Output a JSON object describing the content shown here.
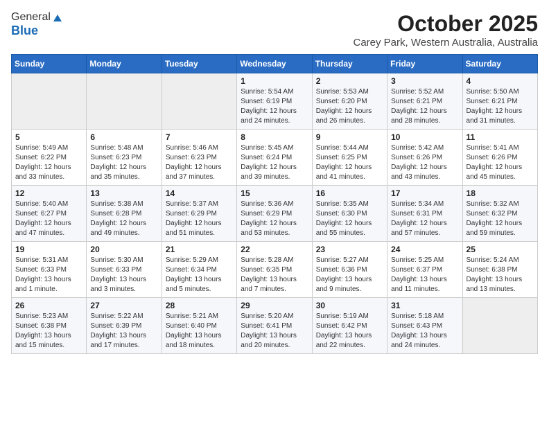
{
  "logo": {
    "line1": "General",
    "line2": "Blue"
  },
  "title": "October 2025",
  "subtitle": "Carey Park, Western Australia, Australia",
  "days_of_week": [
    "Sunday",
    "Monday",
    "Tuesday",
    "Wednesday",
    "Thursday",
    "Friday",
    "Saturday"
  ],
  "weeks": [
    [
      {
        "day": "",
        "text": ""
      },
      {
        "day": "",
        "text": ""
      },
      {
        "day": "",
        "text": ""
      },
      {
        "day": "1",
        "text": "Sunrise: 5:54 AM\nSunset: 6:19 PM\nDaylight: 12 hours\nand 24 minutes."
      },
      {
        "day": "2",
        "text": "Sunrise: 5:53 AM\nSunset: 6:20 PM\nDaylight: 12 hours\nand 26 minutes."
      },
      {
        "day": "3",
        "text": "Sunrise: 5:52 AM\nSunset: 6:21 PM\nDaylight: 12 hours\nand 28 minutes."
      },
      {
        "day": "4",
        "text": "Sunrise: 5:50 AM\nSunset: 6:21 PM\nDaylight: 12 hours\nand 31 minutes."
      }
    ],
    [
      {
        "day": "5",
        "text": "Sunrise: 5:49 AM\nSunset: 6:22 PM\nDaylight: 12 hours\nand 33 minutes."
      },
      {
        "day": "6",
        "text": "Sunrise: 5:48 AM\nSunset: 6:23 PM\nDaylight: 12 hours\nand 35 minutes."
      },
      {
        "day": "7",
        "text": "Sunrise: 5:46 AM\nSunset: 6:23 PM\nDaylight: 12 hours\nand 37 minutes."
      },
      {
        "day": "8",
        "text": "Sunrise: 5:45 AM\nSunset: 6:24 PM\nDaylight: 12 hours\nand 39 minutes."
      },
      {
        "day": "9",
        "text": "Sunrise: 5:44 AM\nSunset: 6:25 PM\nDaylight: 12 hours\nand 41 minutes."
      },
      {
        "day": "10",
        "text": "Sunrise: 5:42 AM\nSunset: 6:26 PM\nDaylight: 12 hours\nand 43 minutes."
      },
      {
        "day": "11",
        "text": "Sunrise: 5:41 AM\nSunset: 6:26 PM\nDaylight: 12 hours\nand 45 minutes."
      }
    ],
    [
      {
        "day": "12",
        "text": "Sunrise: 5:40 AM\nSunset: 6:27 PM\nDaylight: 12 hours\nand 47 minutes."
      },
      {
        "day": "13",
        "text": "Sunrise: 5:38 AM\nSunset: 6:28 PM\nDaylight: 12 hours\nand 49 minutes."
      },
      {
        "day": "14",
        "text": "Sunrise: 5:37 AM\nSunset: 6:29 PM\nDaylight: 12 hours\nand 51 minutes."
      },
      {
        "day": "15",
        "text": "Sunrise: 5:36 AM\nSunset: 6:29 PM\nDaylight: 12 hours\nand 53 minutes."
      },
      {
        "day": "16",
        "text": "Sunrise: 5:35 AM\nSunset: 6:30 PM\nDaylight: 12 hours\nand 55 minutes."
      },
      {
        "day": "17",
        "text": "Sunrise: 5:34 AM\nSunset: 6:31 PM\nDaylight: 12 hours\nand 57 minutes."
      },
      {
        "day": "18",
        "text": "Sunrise: 5:32 AM\nSunset: 6:32 PM\nDaylight: 12 hours\nand 59 minutes."
      }
    ],
    [
      {
        "day": "19",
        "text": "Sunrise: 5:31 AM\nSunset: 6:33 PM\nDaylight: 13 hours\nand 1 minute."
      },
      {
        "day": "20",
        "text": "Sunrise: 5:30 AM\nSunset: 6:33 PM\nDaylight: 13 hours\nand 3 minutes."
      },
      {
        "day": "21",
        "text": "Sunrise: 5:29 AM\nSunset: 6:34 PM\nDaylight: 13 hours\nand 5 minutes."
      },
      {
        "day": "22",
        "text": "Sunrise: 5:28 AM\nSunset: 6:35 PM\nDaylight: 13 hours\nand 7 minutes."
      },
      {
        "day": "23",
        "text": "Sunrise: 5:27 AM\nSunset: 6:36 PM\nDaylight: 13 hours\nand 9 minutes."
      },
      {
        "day": "24",
        "text": "Sunrise: 5:25 AM\nSunset: 6:37 PM\nDaylight: 13 hours\nand 11 minutes."
      },
      {
        "day": "25",
        "text": "Sunrise: 5:24 AM\nSunset: 6:38 PM\nDaylight: 13 hours\nand 13 minutes."
      }
    ],
    [
      {
        "day": "26",
        "text": "Sunrise: 5:23 AM\nSunset: 6:38 PM\nDaylight: 13 hours\nand 15 minutes."
      },
      {
        "day": "27",
        "text": "Sunrise: 5:22 AM\nSunset: 6:39 PM\nDaylight: 13 hours\nand 17 minutes."
      },
      {
        "day": "28",
        "text": "Sunrise: 5:21 AM\nSunset: 6:40 PM\nDaylight: 13 hours\nand 18 minutes."
      },
      {
        "day": "29",
        "text": "Sunrise: 5:20 AM\nSunset: 6:41 PM\nDaylight: 13 hours\nand 20 minutes."
      },
      {
        "day": "30",
        "text": "Sunrise: 5:19 AM\nSunset: 6:42 PM\nDaylight: 13 hours\nand 22 minutes."
      },
      {
        "day": "31",
        "text": "Sunrise: 5:18 AM\nSunset: 6:43 PM\nDaylight: 13 hours\nand 24 minutes."
      },
      {
        "day": "",
        "text": ""
      }
    ]
  ]
}
